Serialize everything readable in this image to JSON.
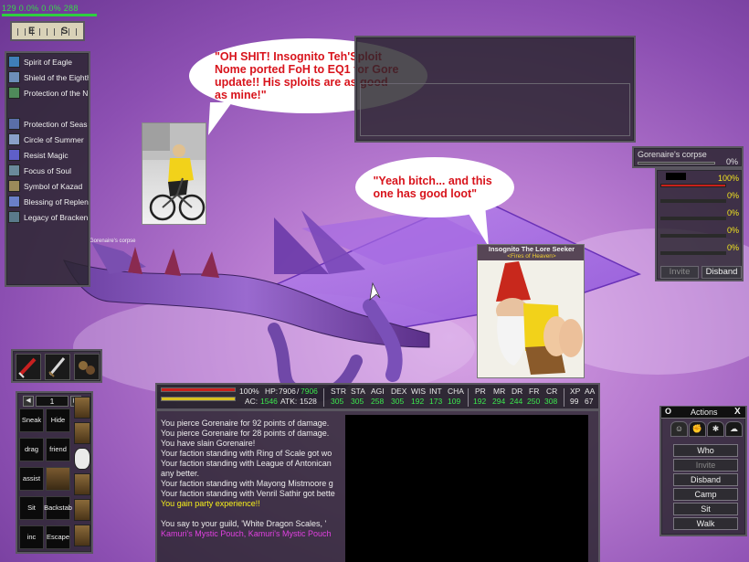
{
  "top_stats": {
    "text": "129   0.0%  0.0%  288"
  },
  "compass": {
    "left_letter": "E",
    "right_letter": "S"
  },
  "buffs": [
    {
      "label": "Spirit of Eagle",
      "color": "#3f7fb8"
    },
    {
      "label": "Shield of the Eighth",
      "color": "#6d8fb8"
    },
    {
      "label": "Protection of the N",
      "color": "#4f8a5a"
    },
    {
      "label": "Protection of Seas",
      "color": "#5a6fa8"
    },
    {
      "label": "Circle of Summer",
      "color": "#8aa0c8"
    },
    {
      "label": "Resist Magic",
      "color": "#5f5fc8"
    },
    {
      "label": "Focus of Soul",
      "color": "#6a8a9a"
    },
    {
      "label": "Symbol of Kazad",
      "color": "#9a8a5a"
    },
    {
      "label": "Blessing of Replen",
      "color": "#6a80c8"
    },
    {
      "label": "Legacy of Bracken",
      "color": "#5a7a8a"
    }
  ],
  "bubbles": {
    "first": "\"OH SHIT!  Insognito Teh'Sploit Nome ported FoH to EQ1 for Gore update!!  His sploits are as good as mine!\"",
    "second": "\"Yeah bitch... and this one has good loot\""
  },
  "gnome_photo": {
    "name": "Insognito The Lore Seeker",
    "title": "<Fires of Heaven>"
  },
  "dragon_nameplate": "Gorenaire's corpse",
  "target": {
    "name": "Gorenaire's corpse",
    "percent": "0%"
  },
  "group": {
    "members": [
      {
        "percent": "100%",
        "fill": 1.0
      },
      {
        "percent": "0%",
        "fill": 0
      },
      {
        "percent": "0%",
        "fill": 0
      },
      {
        "percent": "0%",
        "fill": 0
      },
      {
        "percent": "0%",
        "fill": 0
      }
    ],
    "invite_label": "Invite",
    "disband_label": "Disband"
  },
  "hotbar": {
    "page": "1",
    "prev": "◀",
    "next": "▶",
    "keys": [
      [
        "Sneak",
        "Hide"
      ],
      [
        "drag",
        "friend"
      ],
      [
        "assist",
        ""
      ],
      [
        "Sit",
        "Backstab"
      ],
      [
        "inc",
        "Escape"
      ]
    ]
  },
  "player": {
    "hp_percent": "100%",
    "hp_label": "HP:",
    "hp_current": "7906",
    "hp_max": "7906",
    "ac_label": "AC:",
    "ac_value": "1546",
    "atk_label": "ATK:",
    "atk_value": "1528",
    "attributes": [
      {
        "name": "STR",
        "value": "305"
      },
      {
        "name": "STA",
        "value": "305"
      },
      {
        "name": "AGI",
        "value": "258"
      },
      {
        "name": "DEX",
        "value": "305"
      },
      {
        "name": "WIS",
        "value": "192"
      },
      {
        "name": "INT",
        "value": "173"
      },
      {
        "name": "CHA",
        "value": "109"
      }
    ],
    "resists": [
      {
        "name": "PR",
        "value": "192"
      },
      {
        "name": "MR",
        "value": "294"
      },
      {
        "name": "DR",
        "value": "244"
      },
      {
        "name": "FR",
        "value": "250"
      },
      {
        "name": "CR",
        "value": "308"
      }
    ],
    "xp": {
      "name": "XP",
      "value": "99"
    },
    "aa": {
      "name": "AA",
      "value": "67"
    }
  },
  "chat": [
    {
      "text": "You pierce Gorenaire for 92 points of damage.",
      "color": "w"
    },
    {
      "text": "You pierce Gorenaire for 28 points of damage.",
      "color": "w"
    },
    {
      "text": "You have slain Gorenaire!",
      "color": "w"
    },
    {
      "text": "Your faction standing with Ring of Scale got wo",
      "color": "w"
    },
    {
      "text": "Your faction standing with League of Antonican",
      "color": "w"
    },
    {
      "text": "any better.",
      "color": "w"
    },
    {
      "text": "Your faction standing with Mayong Mistmoore g",
      "color": "w"
    },
    {
      "text": "Your faction standing with Venril Sathir got bette",
      "color": "w"
    },
    {
      "text": "You gain party experience!!",
      "color": "y"
    },
    {
      "text": "You say to your guild, 'White Dragon Scales, '",
      "color": "w"
    },
    {
      "text": "Kamuri's Mystic Pouch, Kamuri's Mystic Pouch",
      "color": "m"
    }
  ],
  "actions": {
    "title": "Actions",
    "o_label": "O",
    "close": "X",
    "tabs": [
      "☺",
      "✊",
      "✱",
      "☁"
    ],
    "buttons": [
      {
        "label": "Who",
        "enabled": true
      },
      {
        "label": "Invite",
        "enabled": false
      },
      {
        "label": "Disband",
        "enabled": true
      },
      {
        "label": "Camp",
        "enabled": true
      },
      {
        "label": "Sit",
        "enabled": true
      },
      {
        "label": "Walk",
        "enabled": true
      }
    ]
  }
}
